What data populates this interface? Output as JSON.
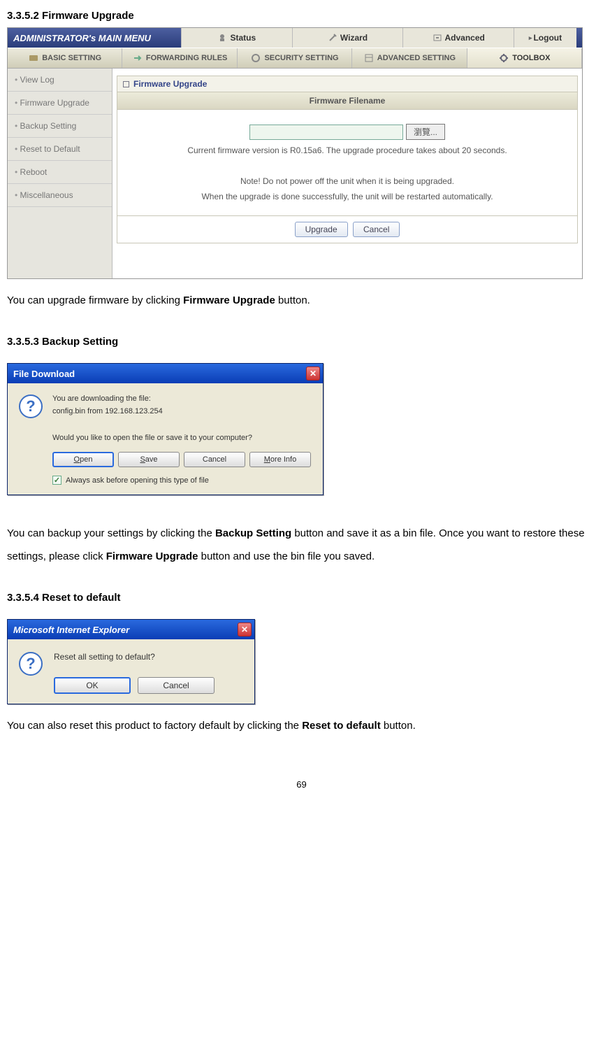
{
  "sections": {
    "s1_heading": "3.3.5.2 Firmware Upgrade",
    "s1_text_a": "You can upgrade firmware by clicking ",
    "s1_text_b": "Firmware Upgrade",
    "s1_text_c": " button.",
    "s2_heading": "3.3.5.3 Backup Setting",
    "s2_text_a": "You can backup your settings by clicking the ",
    "s2_text_b": "Backup Setting",
    "s2_text_c": " button and save it as a bin file. Once you want to restore these settings, please click ",
    "s2_text_d": "Firmware Upgrade",
    "s2_text_e": " button and use the bin file you saved.",
    "s3_heading": "3.3.5.4 Reset to default",
    "s3_text_a": "You can also reset this product to factory default by clicking the ",
    "s3_text_b": "Reset to default",
    "s3_text_c": " button."
  },
  "router": {
    "main_menu": "ADMINISTRATOR's MAIN MENU",
    "top_status": "Status",
    "top_wizard": "Wizard",
    "top_advanced": "Advanced",
    "logout": "Logout",
    "tab_basic": "BASIC SETTING",
    "tab_forward": "FORWARDING RULES",
    "tab_security": "SECURITY SETTING",
    "tab_advset": "ADVANCED SETTING",
    "tab_toolbox": "TOOLBOX",
    "sidebar": {
      "viewlog": "View Log",
      "firmware": "Firmware Upgrade",
      "backup": "Backup Setting",
      "reset": "Reset to Default",
      "reboot": "Reboot",
      "misc": "Miscellaneous"
    },
    "panel_title": "Firmware Upgrade",
    "filename_header": "Firmware Filename",
    "browse_label": "瀏覽...",
    "line_version": "Current firmware version is R0.15a6. The upgrade procedure takes about 20 seconds.",
    "line_note": "Note! Do not power off the unit when it is being upgraded.",
    "line_done": "When the upgrade is done successfully, the unit will be restarted automatically.",
    "btn_upgrade": "Upgrade",
    "btn_cancel": "Cancel"
  },
  "download": {
    "title": "File Download",
    "line1": "You are downloading the file:",
    "line2": "config.bin from 192.168.123.254",
    "question": "Would you like to open the file or save it to your computer?",
    "btn_open": "Open",
    "btn_open_u": "O",
    "btn_save": "Save",
    "btn_save_u": "S",
    "btn_cancel": "Cancel",
    "btn_more": "More Info",
    "btn_more_u": "M",
    "check_label_pre": "Al",
    "check_label_u": "w",
    "check_label_post": "ays ask before opening this type of file"
  },
  "reset": {
    "title": "Microsoft Internet Explorer",
    "question": "Reset all setting to default?",
    "btn_ok": "OK",
    "btn_cancel": "Cancel"
  },
  "page_num": "69"
}
